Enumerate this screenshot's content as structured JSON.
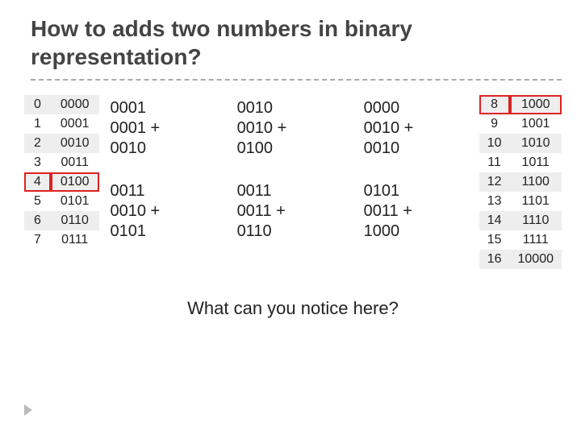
{
  "title": "How to adds two numbers in binary representation?",
  "question": "What can you notice here?",
  "left_table": {
    "highlight_index": 4,
    "rows": [
      {
        "dec": "0",
        "bin": "0000"
      },
      {
        "dec": "1",
        "bin": "0001"
      },
      {
        "dec": "2",
        "bin": "0010"
      },
      {
        "dec": "3",
        "bin": "0011"
      },
      {
        "dec": "4",
        "bin": "0100"
      },
      {
        "dec": "5",
        "bin": "0101"
      },
      {
        "dec": "6",
        "bin": "0110"
      },
      {
        "dec": "7",
        "bin": "0111"
      }
    ]
  },
  "right_table": {
    "highlight_index": 0,
    "rows": [
      {
        "dec": "8",
        "bin": "1000"
      },
      {
        "dec": "9",
        "bin": "1001"
      },
      {
        "dec": "10",
        "bin": "1010"
      },
      {
        "dec": "11",
        "bin": "1011"
      },
      {
        "dec": "12",
        "bin": "1100"
      },
      {
        "dec": "13",
        "bin": "1101"
      },
      {
        "dec": "14",
        "bin": "1110"
      },
      {
        "dec": "15",
        "bin": "1111"
      },
      {
        "dec": "16",
        "bin": "10000"
      }
    ]
  },
  "examples": [
    {
      "a": "0001",
      "b": "0001",
      "sum": "0010"
    },
    {
      "a": "0010",
      "b": "0010",
      "sum": "0100"
    },
    {
      "a": "0000",
      "b": "0010",
      "sum": "0010"
    },
    {
      "a": "0011",
      "b": "0010",
      "sum": "0101"
    },
    {
      "a": "0011",
      "b": "0011",
      "sum": "0110"
    },
    {
      "a": "0101",
      "b": "0011",
      "sum": "1000"
    }
  ]
}
